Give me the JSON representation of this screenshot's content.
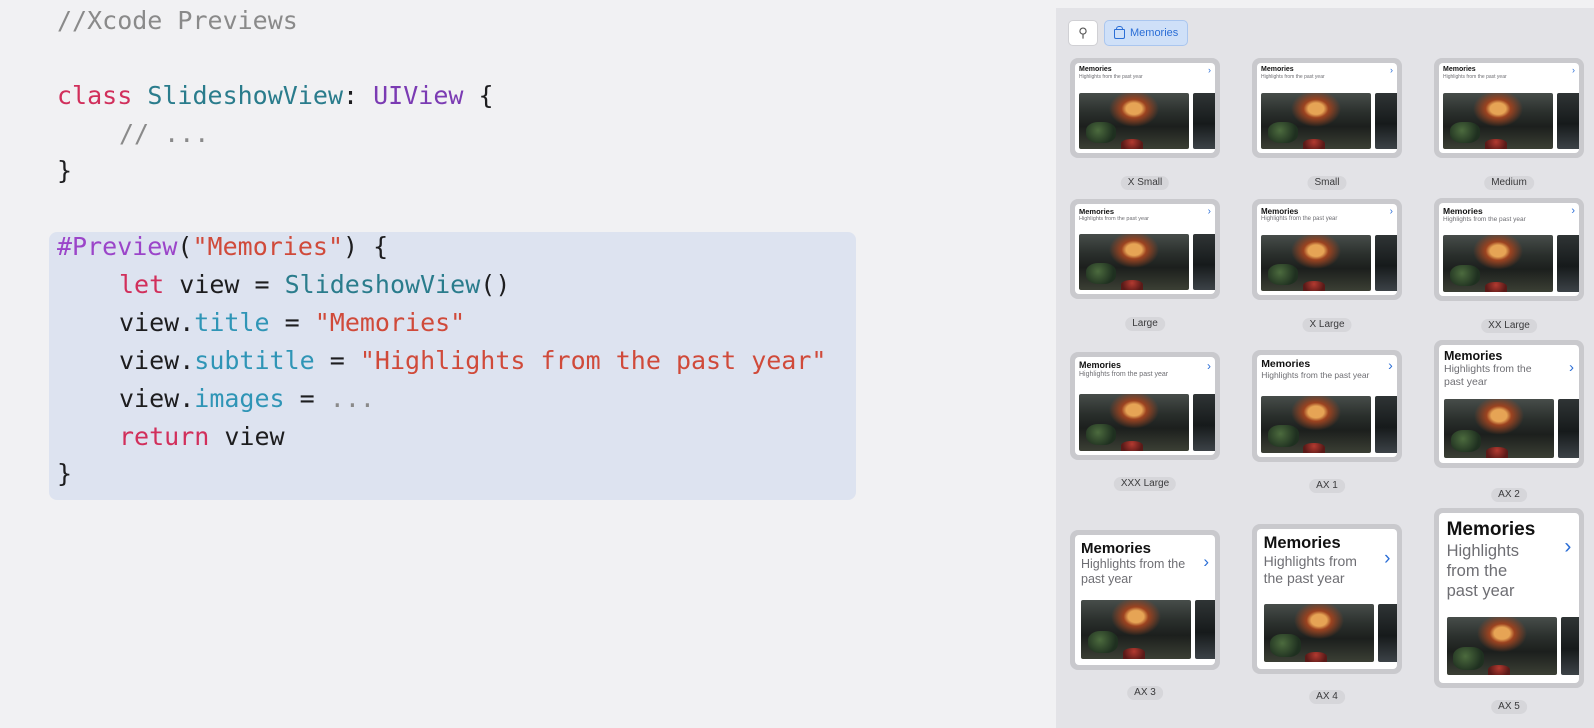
{
  "code": {
    "comment_header": "//Xcode Previews",
    "class_keyword": "class",
    "class_name": "SlideshowView",
    "colon": ":",
    "superclass": "UIView",
    "open_brace": "{",
    "body_comment": "// ...",
    "close_brace": "}",
    "macro": "#Preview",
    "paren_open": "(",
    "preview_name": "\"Memories\"",
    "paren_close_brace": ") {",
    "let_kw": "let",
    "view_decl": "view =",
    "init_type": "SlideshowView",
    "init_parens": "()",
    "view_dot": "view.",
    "prop_title": "title",
    "prop_subtitle": "subtitle",
    "prop_images": "images",
    "equals": "=",
    "title_value": "\"Memories\"",
    "subtitle_value": "\"Highlights from the past year\"",
    "images_value": "...",
    "return_kw": "return",
    "return_value": "view"
  },
  "canvas": {
    "pin_icon": "pin-icon",
    "pin_glyph": "⚲",
    "variant_button_label": "Memories",
    "card_title": "Memories",
    "card_subtitle": "Highlights from the past year",
    "chevron_glyph": "›",
    "sizes": [
      "X Small",
      "Small",
      "Medium",
      "Large",
      "X Large",
      "XX Large",
      "XXX Large",
      "AX 1",
      "AX 2",
      "AX 3",
      "AX 4",
      "AX 5"
    ]
  },
  "colors": {
    "keyword": "#d12f5b",
    "type": "#2a7c8c",
    "string": "#d04a3a",
    "property": "#2f95b6",
    "accent": "#2b6ed6"
  }
}
